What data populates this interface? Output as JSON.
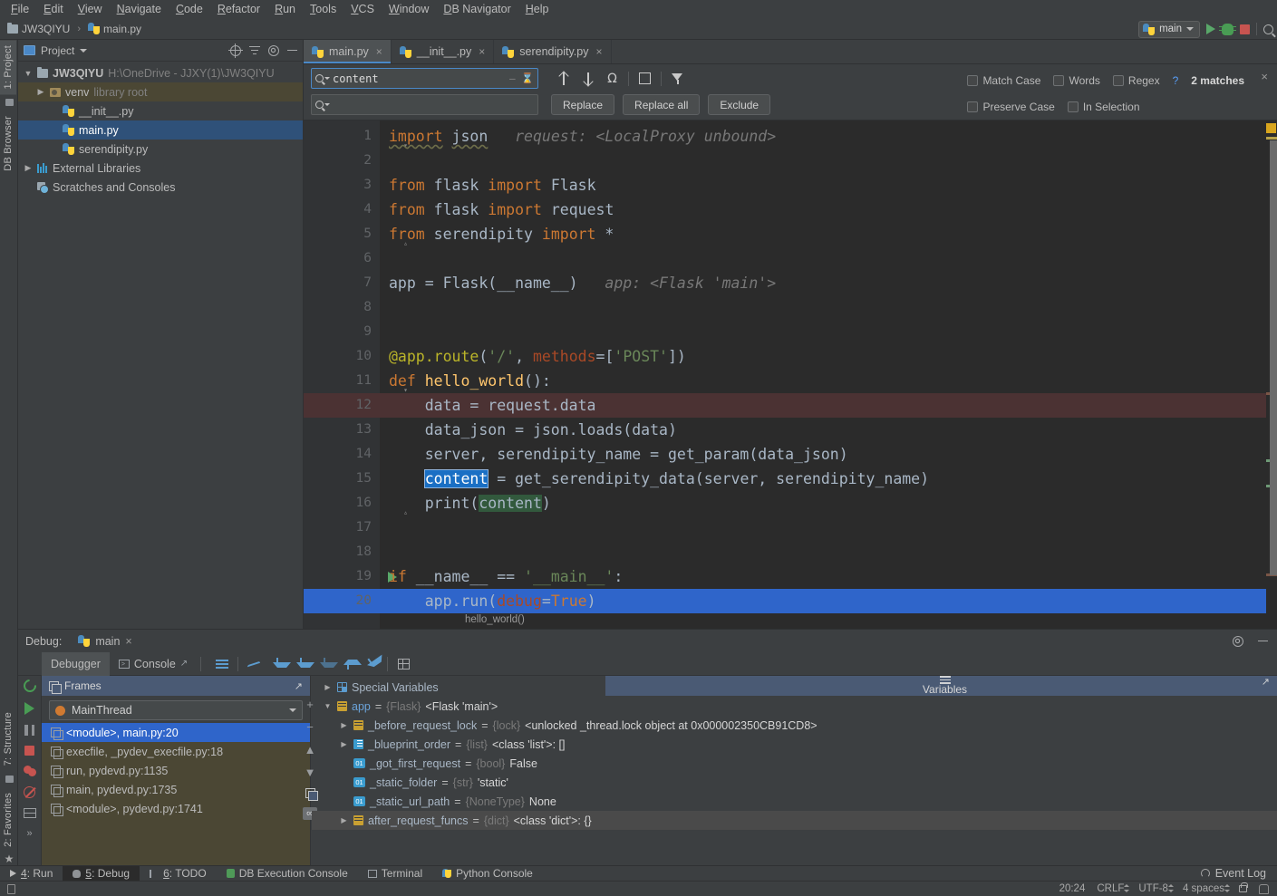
{
  "menu": {
    "items": [
      "File",
      "Edit",
      "View",
      "Navigate",
      "Code",
      "Refactor",
      "Run",
      "Tools",
      "VCS",
      "Window",
      "DB Navigator",
      "Help"
    ]
  },
  "breadcrumb": {
    "project": "JW3QIYU",
    "separator": "›",
    "file": "main.py"
  },
  "run_config": {
    "name": "main",
    "run_icon": "run-triangle-icon",
    "debug_icon": "debug-bug-icon",
    "stop_icon": "stop-square-icon",
    "search_icon": "search-everywhere-icon"
  },
  "left_strip": {
    "top_tabs": [
      "1: Project",
      "DB Browser"
    ],
    "bottom_tabs": [
      "7: Structure",
      "2: Favorites"
    ]
  },
  "project_panel": {
    "title": "Project",
    "tools": [
      "locate-icon",
      "collapse-all-icon",
      "settings-gear-icon",
      "hide-icon"
    ],
    "tree": [
      {
        "label": "JW3QIYU",
        "suffix": "H:\\OneDrive - JJXY(1)\\JW3QIYU",
        "indent": 0,
        "arrow": "▼",
        "icon": "folder-icon",
        "state": "normal"
      },
      {
        "label": "venv",
        "suffix": "library root",
        "indent": 1,
        "arrow": "▶",
        "icon": "venv-folder-icon",
        "state": "venv"
      },
      {
        "label": "__init__.py",
        "suffix": "",
        "indent": 2,
        "arrow": "",
        "icon": "python-file-icon",
        "state": "normal"
      },
      {
        "label": "main.py",
        "suffix": "",
        "indent": 2,
        "arrow": "",
        "icon": "python-file-icon",
        "state": "selected"
      },
      {
        "label": "serendipity.py",
        "suffix": "",
        "indent": 2,
        "arrow": "",
        "icon": "python-file-icon",
        "state": "normal"
      },
      {
        "label": "External Libraries",
        "suffix": "",
        "indent": 0,
        "arrow": "▶",
        "icon": "libraries-icon",
        "state": "normal"
      },
      {
        "label": "Scratches and Consoles",
        "suffix": "",
        "indent": 0,
        "arrow": "",
        "icon": "scratches-icon",
        "state": "normal"
      }
    ]
  },
  "editor_tabs": [
    {
      "label": "main.py",
      "active": true
    },
    {
      "label": "__init__.py",
      "active": false
    },
    {
      "label": "serendipity.py",
      "active": false
    }
  ],
  "find_replace": {
    "search_value": "content",
    "replace_value": "",
    "replace_placeholder": "",
    "buttons": [
      "Replace",
      "Replace all",
      "Exclude"
    ],
    "checkboxes_row1": [
      {
        "label": "Match Case",
        "checked": false
      },
      {
        "label": "Words",
        "checked": false
      },
      {
        "label": "Regex",
        "checked": false
      }
    ],
    "checkboxes_row2": [
      {
        "label": "Preserve Case",
        "checked": false
      },
      {
        "label": "In Selection",
        "checked": false
      }
    ],
    "help": "?",
    "match_count": "2 matches",
    "close": "×",
    "nav_icons": [
      "find-previous-icon",
      "find-next-icon",
      "select-all-occurrences-icon",
      "add-selection-icon",
      "filter-icon"
    ]
  },
  "code": {
    "lines": [
      {
        "n": 1,
        "state": "normal",
        "gutter": "fold-open",
        "tokens": [
          {
            "t": "import",
            "c": "k",
            "sq": true
          },
          {
            "t": " ",
            "c": "id"
          },
          {
            "t": "json",
            "c": "id",
            "sq": true
          }
        ],
        "hint": "request: <LocalProxy unbound>"
      },
      {
        "n": 2,
        "state": "normal",
        "gutter": "",
        "tokens": [],
        "hint": ""
      },
      {
        "n": 3,
        "state": "normal",
        "gutter": "",
        "tokens": [
          {
            "t": "from",
            "c": "k"
          },
          {
            "t": " flask ",
            "c": "id"
          },
          {
            "t": "import",
            "c": "k"
          },
          {
            "t": " Flask",
            "c": "id"
          }
        ],
        "hint": ""
      },
      {
        "n": 4,
        "state": "normal",
        "gutter": "",
        "tokens": [
          {
            "t": "from",
            "c": "k"
          },
          {
            "t": " flask ",
            "c": "id"
          },
          {
            "t": "import",
            "c": "k"
          },
          {
            "t": " request",
            "c": "id"
          }
        ],
        "hint": ""
      },
      {
        "n": 5,
        "state": "normal",
        "gutter": "fold-close",
        "tokens": [
          {
            "t": "from",
            "c": "k"
          },
          {
            "t": " serendipity ",
            "c": "id"
          },
          {
            "t": "import",
            "c": "k"
          },
          {
            "t": " *",
            "c": "id"
          }
        ],
        "hint": ""
      },
      {
        "n": 6,
        "state": "normal",
        "gutter": "",
        "tokens": [],
        "hint": ""
      },
      {
        "n": 7,
        "state": "normal",
        "gutter": "",
        "tokens": [
          {
            "t": "app = Flask(__name__)",
            "c": "id"
          }
        ],
        "hint": "app: <Flask 'main'>"
      },
      {
        "n": 8,
        "state": "normal",
        "gutter": "",
        "tokens": [],
        "hint": ""
      },
      {
        "n": 9,
        "state": "normal",
        "gutter": "",
        "tokens": [],
        "hint": ""
      },
      {
        "n": 10,
        "state": "normal",
        "gutter": "",
        "tokens": [
          {
            "t": "@app.route",
            "c": "dec"
          },
          {
            "t": "(",
            "c": "id"
          },
          {
            "t": "'/'",
            "c": "s"
          },
          {
            "t": ", ",
            "c": "id"
          },
          {
            "t": "methods",
            "c": "kwarg"
          },
          {
            "t": "=[",
            "c": "id"
          },
          {
            "t": "'POST'",
            "c": "s"
          },
          {
            "t": "])",
            "c": "id"
          }
        ],
        "hint": ""
      },
      {
        "n": 11,
        "state": "normal",
        "gutter": "fold-open",
        "tokens": [
          {
            "t": "def",
            "c": "k"
          },
          {
            "t": " ",
            "c": "id"
          },
          {
            "t": "hello_world",
            "c": "fn"
          },
          {
            "t": "():",
            "c": "id"
          }
        ],
        "hint": ""
      },
      {
        "n": 12,
        "state": "bpline",
        "gutter": "breakpoint",
        "tokens": [
          {
            "t": "    data = request.data",
            "c": "id"
          }
        ],
        "hint": ""
      },
      {
        "n": 13,
        "state": "normal",
        "gutter": "",
        "tokens": [
          {
            "t": "    data_json = json.loads(data)",
            "c": "id"
          }
        ],
        "hint": ""
      },
      {
        "n": 14,
        "state": "normal",
        "gutter": "",
        "tokens": [
          {
            "t": "    server, serendipity_name = get_param(data_json)",
            "c": "id"
          }
        ],
        "hint": ""
      },
      {
        "n": 15,
        "state": "normal",
        "gutter": "",
        "tokens": [
          {
            "t": "    ",
            "c": "id"
          },
          {
            "t": "content",
            "c": "sel-match"
          },
          {
            "t": " = get_serendipity_data(server, serendipity_name)",
            "c": "id"
          }
        ],
        "hint": ""
      },
      {
        "n": 16,
        "state": "normal",
        "gutter": "fold-close",
        "tokens": [
          {
            "t": "    print(",
            "c": "id"
          },
          {
            "t": "content",
            "c": "grn-match"
          },
          {
            "t": ")",
            "c": "id"
          }
        ],
        "hint": ""
      },
      {
        "n": 17,
        "state": "normal",
        "gutter": "",
        "tokens": [],
        "hint": ""
      },
      {
        "n": 18,
        "state": "normal",
        "gutter": "",
        "tokens": [],
        "hint": ""
      },
      {
        "n": 19,
        "state": "normal",
        "gutter": "runmark",
        "tokens": [
          {
            "t": "if",
            "c": "k"
          },
          {
            "t": " __name__ == ",
            "c": "id"
          },
          {
            "t": "'__main__'",
            "c": "s"
          },
          {
            "t": ":",
            "c": "id"
          }
        ],
        "hint": ""
      },
      {
        "n": 20,
        "state": "execline",
        "gutter": "breakpoint",
        "tokens": [
          {
            "t": "    app.run(",
            "c": "id"
          },
          {
            "t": "debug",
            "c": "kwarg"
          },
          {
            "t": "=",
            "c": "id"
          },
          {
            "t": "True",
            "c": "k"
          },
          {
            "t": ")",
            "c": "id"
          }
        ],
        "hint": ""
      }
    ],
    "footer_hint": "hello_world()"
  },
  "debug": {
    "label": "Debug:",
    "session": "main",
    "session_close": "×",
    "tabs": [
      {
        "label": "Debugger",
        "active": true
      },
      {
        "label": "Console",
        "active": false
      }
    ],
    "toolbar_icons": [
      "mute-breakpoints-icon",
      "step-over-icon",
      "step-into-icon",
      "force-step-into-icon",
      "step-into-my-code-icon",
      "step-out-icon",
      "run-to-cursor-icon",
      "evaluate-expression-icon"
    ],
    "side_icons": [
      "rerun-icon",
      "resume-program-icon",
      "pause-program-icon",
      "stop-icon",
      "view-breakpoints-icon",
      "mute-breakpoints-icon",
      "layout-settings-icon",
      "more-icon"
    ],
    "header_icons": [
      "settings-gear-icon",
      "hide-panel-icon"
    ],
    "frames": {
      "title": "Frames",
      "thread": "MainThread",
      "rows": [
        {
          "label": "<module>, main.py:20",
          "selected": true
        },
        {
          "label": "execfile, _pydev_execfile.py:18",
          "selected": false
        },
        {
          "label": "run, pydevd.py:1135",
          "selected": false
        },
        {
          "label": "main, pydevd.py:1735",
          "selected": false
        },
        {
          "label": "<module>, pydevd.py:1741",
          "selected": false
        }
      ]
    },
    "variables": {
      "title": "Variables",
      "rows": [
        {
          "indent": 0,
          "arrow": "▶",
          "icon": "special-variables-icon",
          "name": "Special Variables",
          "type": "",
          "value": "",
          "name_color": "plain",
          "last": false
        },
        {
          "indent": 0,
          "arrow": "▼",
          "icon": "object-icon",
          "name": "app",
          "type": "{Flask}",
          "value": "<Flask 'main'>",
          "name_color": "blue",
          "last": false
        },
        {
          "indent": 1,
          "arrow": "▶",
          "icon": "object-icon",
          "name": "_before_request_lock",
          "type": "{lock}",
          "value": "<unlocked _thread.lock object at 0x000002350CB91CD8>",
          "name_color": "plain",
          "last": false
        },
        {
          "indent": 1,
          "arrow": "▶",
          "icon": "list-icon",
          "name": "_blueprint_order",
          "type": "{list}",
          "value": "<class 'list'>: []",
          "name_color": "plain",
          "last": false
        },
        {
          "indent": 1,
          "arrow": "",
          "icon": "primitive-icon",
          "name": "_got_first_request",
          "type": "{bool}",
          "value": "False",
          "name_color": "plain",
          "last": false
        },
        {
          "indent": 1,
          "arrow": "",
          "icon": "primitive-icon",
          "name": "_static_folder",
          "type": "{str}",
          "value": "'static'",
          "name_color": "plain",
          "last": false
        },
        {
          "indent": 1,
          "arrow": "",
          "icon": "primitive-icon",
          "name": "_static_url_path",
          "type": "{NoneType}",
          "value": "None",
          "name_color": "plain",
          "last": false
        },
        {
          "indent": 1,
          "arrow": "▶",
          "icon": "object-icon",
          "name": "after_request_funcs",
          "type": "{dict}",
          "value": "<class 'dict'>: {}",
          "name_color": "plain",
          "last": true
        }
      ]
    }
  },
  "tool_window_bar": {
    "items": [
      {
        "label": "4: Run",
        "icon": "run-triangle-icon",
        "active": false
      },
      {
        "label": "5: Debug",
        "icon": "debug-bug-icon",
        "active": true
      },
      {
        "label": "6: TODO",
        "icon": "todo-list-icon",
        "active": false
      },
      {
        "label": "DB Execution Console",
        "icon": "db-console-icon",
        "active": false
      },
      {
        "label": "Terminal",
        "icon": "terminal-icon",
        "active": false
      },
      {
        "label": "Python Console",
        "icon": "python-console-icon",
        "active": false
      }
    ],
    "event_log": "Event Log"
  },
  "status_bar": {
    "position": "20:24",
    "line_sep": "CRLF",
    "encoding": "UTF-8",
    "indent": "4 spaces",
    "lock_icon": "lock-open-icon",
    "train_icon": "background-tasks-icon"
  }
}
